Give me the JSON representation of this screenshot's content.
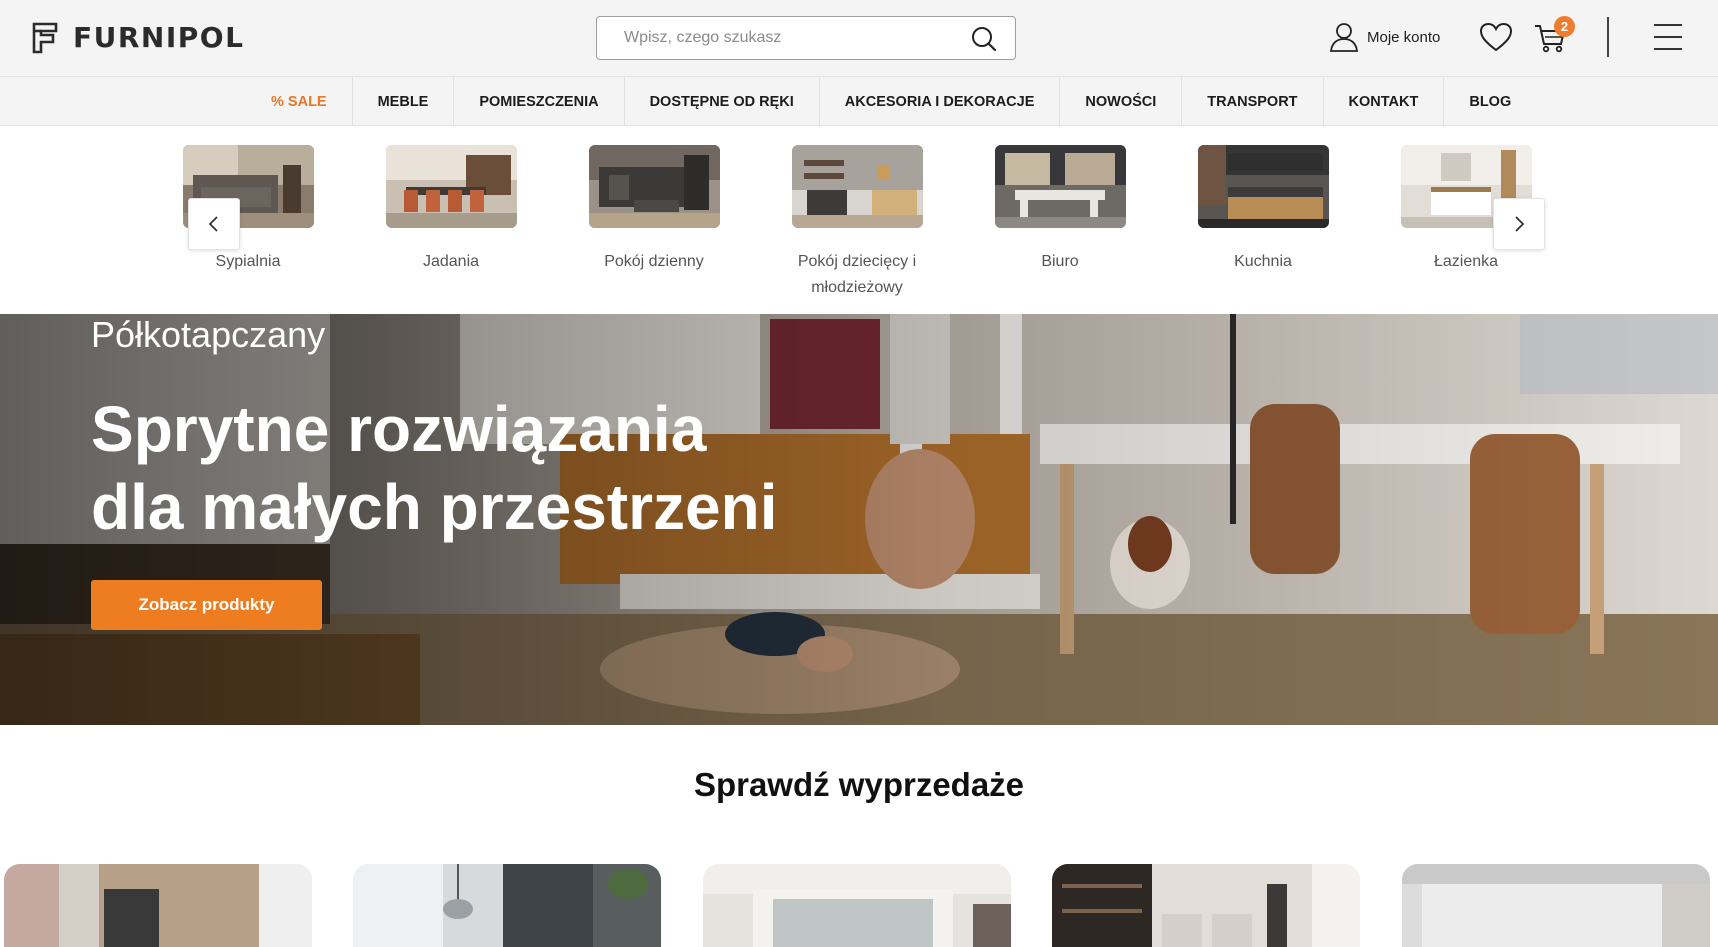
{
  "header": {
    "logo_text": "FURNIPOL",
    "search_placeholder": "Wpisz, czego szukasz",
    "account_label": "Moje konto",
    "cart_count": "2",
    "icons": [
      "search-icon",
      "user-icon",
      "heart-icon",
      "cart-icon",
      "menu-icon"
    ]
  },
  "nav": {
    "items": [
      "% SALE",
      "MEBLE",
      "POMIESZCZENIA",
      "DOSTĘPNE OD RĘKI",
      "AKCESORIA I DEKORACJE",
      "NOWOŚCI",
      "TRANSPORT",
      "KONTAKT",
      "BLOG"
    ]
  },
  "categories": {
    "items": [
      "Sypialnia",
      "Jadania",
      "Pokój dzienny",
      "Pokój dziecięcy i młodzieżowy",
      "Biuro",
      "Kuchnia",
      "Łazienka"
    ]
  },
  "hero": {
    "eyebrow": "Półkotapczany",
    "title_line1": "Sprytne rozwiązania",
    "title_line2": "dla małych przestrzeni",
    "cta": "Zobacz produkty"
  },
  "sales": {
    "title": "Sprawdź wyprzedaże"
  },
  "colors": {
    "accent": "#ee7d22",
    "sale": "#e8762b",
    "header_bg": "#f4f4f4"
  }
}
